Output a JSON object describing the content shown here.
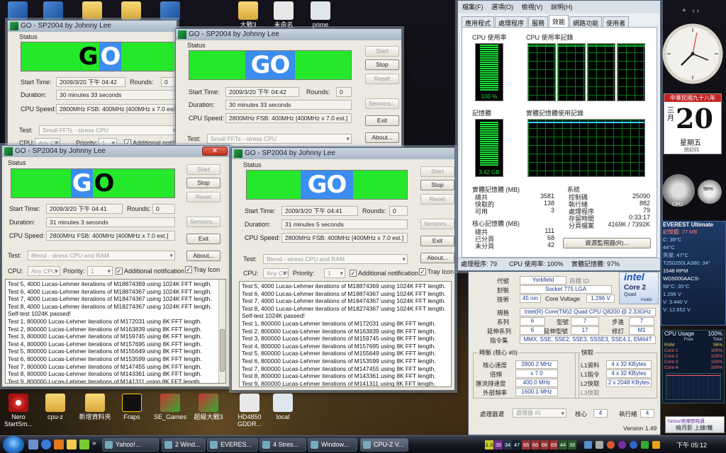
{
  "desktop_icons_top": [
    {
      "label": "",
      "x": 1
    },
    {
      "label": "",
      "x": 2
    },
    {
      "label": "",
      "x": 3
    },
    {
      "label": "大戰3",
      "x": 4
    },
    {
      "label": "未命名",
      "x": 5
    },
    {
      "label": "prime",
      "x": 6
    }
  ],
  "desktop_icons_bottom": [
    {
      "label": "Nero StartSm..."
    },
    {
      "label": "cpu-z"
    },
    {
      "label": "新增資料夾"
    },
    {
      "label": "Fraps"
    },
    {
      "label": "SE_Games"
    },
    {
      "label": "超級大戰3"
    },
    {
      "label": "HD4850 GDDR..."
    },
    {
      "label": "local"
    }
  ],
  "sp_windows": [
    {
      "title": "GO - SP2004 by Johnny Lee",
      "status_label": "Status",
      "go_style": "split",
      "go_text": "GO",
      "start_time_label": "Start Time:",
      "start_time": "2009/3/20 下午 04:42",
      "rounds_label": "Rounds:",
      "rounds": "0",
      "duration_label": "Duration:",
      "duration": "30 minutes 33 seconds",
      "cpu_speed_label": "CPU Speed:",
      "cpu_speed": "2800MHz FSB: 400MHz [400MHz x 7.0 est.]",
      "test_label": "Test:",
      "test": "Small FFTs - stress CPU",
      "cpu_label": "CPU:",
      "cpu": "Any CPU",
      "priority_label": "Priority:",
      "priority": "1",
      "additional_label": "Additional notifica"
    },
    {
      "title": "GO - SP2004 by Johnny Lee",
      "status_label": "Status",
      "go_style": "white",
      "go_text": "GO",
      "start_time_label": "Start Time:",
      "start_time": "2009/3/20 下午 04:42",
      "rounds_label": "Rounds:",
      "rounds": "0",
      "duration_label": "Duration:",
      "duration": "30 minutes 33 seconds",
      "cpu_speed_label": "CPU Speed:",
      "cpu_speed": "2800MHz FSB: 400MHz [400MHz x 7.0 est.]",
      "test_label": "Test:",
      "test": "Small FFTs - stress CPU",
      "btn_start": "Start",
      "btn_stop": "Stop",
      "btn_reset": "Reset",
      "btn_sensors": "Sensors...",
      "btn_exit": "Exit",
      "btn_about": "About..."
    },
    {
      "title": "GO - SP2004 by Johnny Lee",
      "status_label": "Status",
      "go_style": "split-inv",
      "go_text": "GO",
      "start_time_label": "Start Time:",
      "start_time": "2009/3/20 下午 04:41",
      "rounds_label": "Rounds:",
      "rounds": "0",
      "duration_label": "Duration:",
      "duration": "31 minutes 3 seconds",
      "cpu_speed_label": "CPU Speed:",
      "cpu_speed": "2800MHz FSB: 400MHz [400MHz x 7.0 est.]",
      "test_label": "Test:",
      "test": "Blend - stress CPU and RAM",
      "cpu_label": "CPU:",
      "cpu": "Any CPU",
      "priority_label": "Priority:",
      "priority": "1",
      "additional_label": "Additional notification",
      "tray_label": "Tray Icon",
      "btn_start": "Start",
      "btn_stop": "Stop",
      "btn_reset": "Reset",
      "btn_sensors": "Sensors...",
      "btn_exit": "Exit",
      "btn_about": "About...",
      "log": [
        "Test 5, 4000 Lucas-Lehmer iterations of M18874369 using 1024K FFT length.",
        "Test 6, 4000 Lucas-Lehmer iterations of M18874367 using 1024K FFT length.",
        "Test 7, 4000 Lucas-Lehmer iterations of M18474367 using 1024K FFT length.",
        "Test 8, 4000 Lucas-Lehmer iterations of M18274367 using 1024K FFT length.",
        "Self-test 1024K passed!",
        "Test 1, 800000 Lucas-Lehmer iterations of M172031 using 8K FFT length.",
        "Test 2, 800000 Lucas-Lehmer iterations of M163839 using 8K FFT length.",
        "Test 3, 800000 Lucas-Lehmer iterations of M159745 using 8K FFT length.",
        "Test 4, 800000 Lucas-Lehmer iterations of M157695 using 8K FFT length.",
        "Test 5, 800000 Lucas-Lehmer iterations of M155649 using 8K FFT length.",
        "Test 6, 800000 Lucas-Lehmer iterations of M153599 using 8K FFT length.",
        "Test 7, 800000 Lucas-Lehmer iterations of M147455 using 8K FFT length.",
        "Test 8, 800000 Lucas-Lehmer iterations of M143361 using 8K FFT length.",
        "Test 9, 800000 Lucas-Lehmer iterations of M141311 using 8K FFT length."
      ]
    },
    {
      "title": "GO - SP2004 by Johnny Lee",
      "status_label": "Status",
      "go_style": "white",
      "go_text": "GO",
      "start_time_label": "Start Time:",
      "start_time": "2009/3/20 下午 04:41",
      "rounds_label": "Rounds:",
      "rounds": "0",
      "duration_label": "Duration:",
      "duration": "31 minutes 5 seconds",
      "cpu_speed_label": "CPU Speed:",
      "cpu_speed": "2800MHz FSB: 400MHz [400MHz x 7.0 est.]",
      "test_label": "Test:",
      "test": "Blend - stress CPU and RAM",
      "cpu_label": "CPU:",
      "cpu": "Any CPU",
      "priority_label": "Priority:",
      "priority": "1",
      "additional_label": "Additional notification",
      "tray_label": "Tray Icon",
      "btn_start": "Start",
      "btn_stop": "Stop",
      "btn_reset": "Reset",
      "btn_sensors": "Sensors...",
      "btn_exit": "Exit",
      "btn_about": "About...",
      "log": [
        "Test 5, 4000 Lucas-Lehmer iterations of M18874369 using 1024K FFT length.",
        "Test 6, 4000 Lucas-Lehmer iterations of M18874367 using 1024K FFT length.",
        "Test 7, 4000 Lucas-Lehmer iterations of M18474367 using 1024K FFT length.",
        "Test 8, 4000 Lucas-Lehmer iterations of M18274367 using 1024K FFT length.",
        "Self-test 1024K passed!",
        "Test 1, 800000 Lucas-Lehmer iterations of M172031 using 8K FFT length.",
        "Test 2, 800000 Lucas-Lehmer iterations of M163839 using 8K FFT length.",
        "Test 3, 800000 Lucas-Lehmer iterations of M159745 using 8K FFT length.",
        "Test 4, 800000 Lucas-Lehmer iterations of M157695 using 8K FFT length.",
        "Test 5, 800000 Lucas-Lehmer iterations of M155649 using 8K FFT length.",
        "Test 6, 800000 Lucas-Lehmer iterations of M153599 using 8K FFT length.",
        "Test 7, 800000 Lucas-Lehmer iterations of M147455 using 8K FFT length.",
        "Test 8, 800000 Lucas-Lehmer iterations of M143361 using 8K FFT length.",
        "Test 9, 800000 Lucas-Lehmer iterations of M141311 using 8K FFT length."
      ]
    }
  ],
  "task_manager": {
    "menu": [
      "檔案(F)",
      "選項(O)",
      "檢視(V)",
      "說明(H)"
    ],
    "tabs": [
      "應用程式",
      "處理程序",
      "服務",
      "效能",
      "網路功能",
      "使用者"
    ],
    "active_tab": "效能",
    "cpu_usage_title": "CPU 使用率",
    "cpu_history_title": "CPU 使用率記錄",
    "cpu_usage_value": "100 %",
    "cpu_usage_fraction": 1.0,
    "memory_title": "記憶體",
    "memory_history_title": "實體記憶體使用記錄",
    "memory_value": "3.42 GB",
    "memory_fraction": 0.97,
    "physical_memory_title": "實體記憶體 (MB)",
    "physical_rows": [
      {
        "label": "總共",
        "value": "3581"
      },
      {
        "label": "快取的",
        "value": "138"
      },
      {
        "label": "可用",
        "value": "3"
      }
    ],
    "kernel_memory_title": "核心記憶體 (MB)",
    "kernel_rows": [
      {
        "label": "總共",
        "value": "111"
      },
      {
        "label": "已分頁",
        "value": "68"
      },
      {
        "label": "未分頁",
        "value": "42"
      }
    ],
    "system_title": "系統",
    "system_rows": [
      {
        "label": "控制碼",
        "value": "25090"
      },
      {
        "label": "執行緒",
        "value": "882"
      },
      {
        "label": "處理程序",
        "value": "79"
      },
      {
        "label": "存留時間",
        "value": "0:33:17"
      },
      {
        "label": "分頁檔案",
        "value": "4169K / 7392K"
      }
    ],
    "resource_monitor_button": "資源監視器(R)...",
    "status_processes": "處理程序: 79",
    "status_cpu": "CPU 使用率: 100%",
    "status_memory": "實體記憶體: 97%"
  },
  "cpuz": {
    "codename_label": "代號",
    "codename": "Yorkfield",
    "brand_id_label": "商標 ID",
    "package_label": "封裝",
    "package": "Socket 775 LGA",
    "technology_label": "技術",
    "technology": "45 nm",
    "core_voltage_label": "Core Voltage",
    "core_voltage": "1.296 V",
    "spec_label": "規格",
    "spec": "Intel(R) Core(TM)2 Quad  CPU  Q8200 @ 2.33GHz",
    "family_label": "系列",
    "family": "6",
    "model_label": "型號",
    "model": "7",
    "stepping_label": "步進",
    "stepping": "7",
    "ext_family_label": "延伸系列",
    "ext_family": "6",
    "ext_model_label": "延伸型號",
    "ext_model": "17",
    "revision_label": "修訂",
    "revision": "M1",
    "instructions_label": "指令集",
    "instructions": "MMX, SSE, SSE2, SSE3, SSSE3, SSE4.1, EM64T",
    "clocks_title": "時脈 (核心 #0)",
    "core_speed_label": "核心速度",
    "core_speed": "2800.2 MHz",
    "multiplier_label": "倍頻",
    "multiplier": "x 7.0",
    "bus_speed_label": "匯流排速度",
    "bus_speed": "400.0 MHz",
    "rated_fsb_label": "外部頻率",
    "rated_fsb": "1600.1 MHz",
    "cache_title": "快取",
    "l1d_label": "L1資料",
    "l1d": "4 x 32 KBytes",
    "l1i_label": "L1指令",
    "l1i": "4 x 32 KBytes",
    "l2_label": "L2快取",
    "l2": "2 x 2048 KBytes",
    "l3_label": "L3快取",
    "l3": "",
    "selection_label": "處理器選",
    "selection": "處理器 #1",
    "cores_label": "核心",
    "cores": "4",
    "threads_label": "執行緒",
    "threads": "4",
    "version": "Version 1.49",
    "intel_logo": "intel",
    "core2_logo": "Core 2",
    "quad_logo": "Quad",
    "inside_logo": "inside"
  },
  "sidebar": {
    "calendar_header": "中華民國九十八年",
    "month": "三月",
    "day": "20",
    "weekday": "星期五",
    "lunar": "閏初四",
    "everest_title": "EVEREST Ultimate",
    "everest_lines": [
      "記憶體: 77 MB",
      "C: 39°C",
      "44°C",
      "夾度: 47°C",
      "T250250LA380: 34°",
      "1548 RPM",
      "WD5000AACS-",
      "56°C: 35°C",
      "1.296 V",
      "V: 3.440 V",
      "V: 12.652 V"
    ],
    "cpu_usage_title": "CPU Usage",
    "cpu_usage_value": "100%",
    "cpu_usage_table_header": [
      "",
      "Free",
      "Total"
    ],
    "cpu_usage_table": [
      [
        "RAM",
        "",
        "98%"
      ],
      [
        "Core 1",
        "",
        "100%"
      ],
      [
        "Core 2",
        "",
        "100%"
      ],
      [
        "Core 3",
        "",
        "100%"
      ],
      [
        "Core 4",
        "",
        "100%"
      ]
    ],
    "gauge_value": "98%",
    "yahoo_label": "Yahoo!奇摩即時通",
    "yahoo_status": "暗月影 上線/離",
    "cpu_label": "CPU"
  },
  "taskbar": {
    "items": [
      {
        "label": "Yahoo!..."
      },
      {
        "label": "2 Wind..."
      },
      {
        "label": "EVERES..."
      },
      {
        "label": "4 Stres..."
      },
      {
        "label": "Window..."
      },
      {
        "label": "CPU-Z V..."
      }
    ],
    "tray_numbers": [
      "1.3",
      "35",
      "34",
      "47",
      "66",
      "66",
      "66",
      "69",
      "44",
      "39"
    ],
    "clock": "下午 05:12"
  }
}
